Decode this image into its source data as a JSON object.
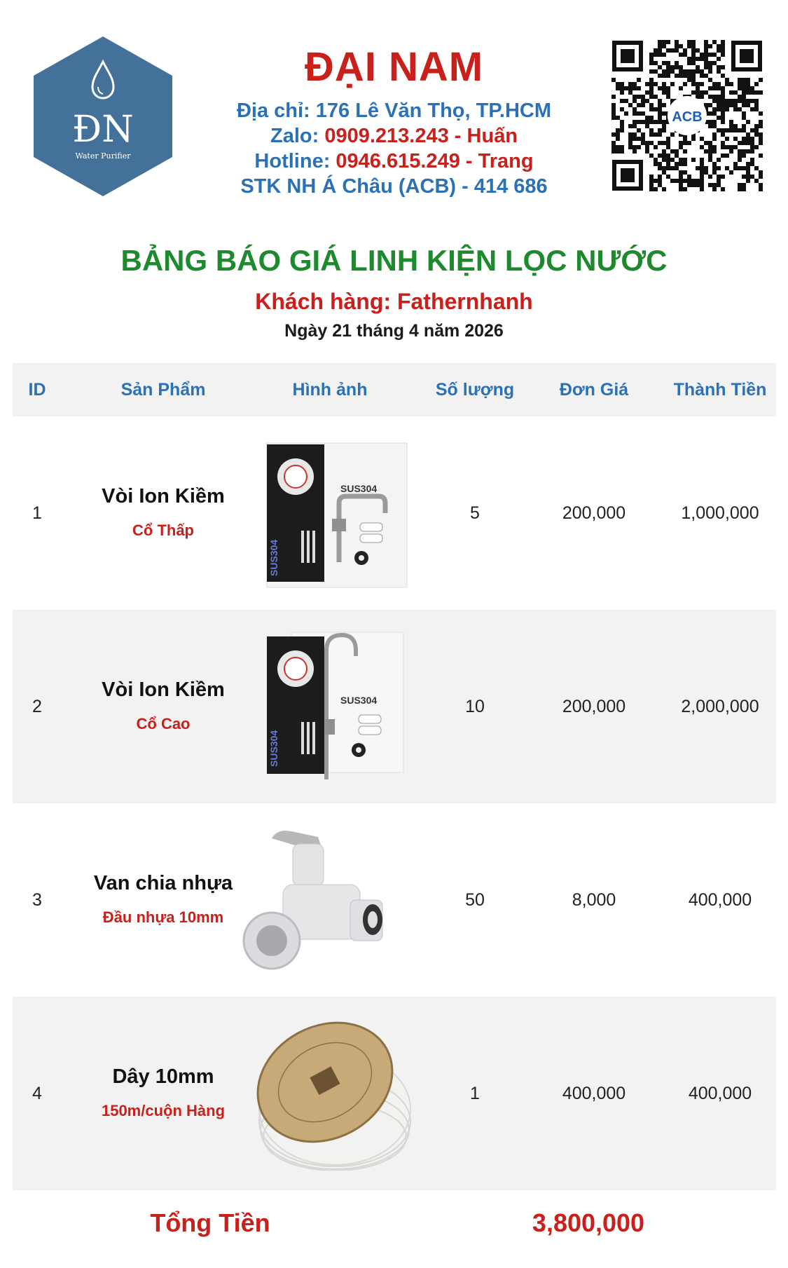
{
  "header": {
    "logo": {
      "monogram": "ĐN",
      "tagline": "Water Purifier"
    },
    "company_name": "ĐẠI NAM",
    "address_label": "Địa chỉ: ",
    "address_value": "176 Lê Văn Thọ, TP.HCM",
    "zalo_label": "Zalo: ",
    "zalo_value": "0909.213.243 - Huấn",
    "hotline_label": "Hotline: ",
    "hotline_value": "0946.615.249 - Trang",
    "bank_text": "STK NH Á Châu (ACB) - 414 686",
    "qr_badge": "ACB"
  },
  "document": {
    "title": "BẢNG BÁO GIÁ LINH KIỆN LỌC NƯỚC",
    "customer": "Khách hàng: Fathernhanh",
    "date": "Ngày 21 tháng 4 năm 2026"
  },
  "table": {
    "columns": [
      "ID",
      "Sản Phẩm",
      "Hình ảnh",
      "Số lượng",
      "Đơn Giá",
      "Thành Tiền"
    ],
    "rows": [
      {
        "id": "1",
        "name": "Vòi Ion Kiềm",
        "sub": "Cổ Thấp",
        "image": "sus304-faucet-low-neck-icon",
        "qty": "5",
        "price": "200,000",
        "total": "1,000,000"
      },
      {
        "id": "2",
        "name": "Vòi Ion Kiềm",
        "sub": "Cổ Cao",
        "image": "sus304-faucet-high-neck-icon",
        "qty": "10",
        "price": "200,000",
        "total": "2,000,000"
      },
      {
        "id": "3",
        "name": "Van chia nhựa",
        "sub": "Đầu nhựa 10mm",
        "image": "plastic-valve-icon",
        "qty": "50",
        "price": "8,000",
        "total": "400,000"
      },
      {
        "id": "4",
        "name": "Dây 10mm",
        "sub": "150m/cuộn Hàng",
        "image": "hose-coil-icon",
        "qty": "1",
        "price": "400,000",
        "total": "400,000"
      }
    ]
  },
  "summary": {
    "label": "Tổng Tiền",
    "value": "3,800,000"
  },
  "colors": {
    "red": "#c9201b",
    "blue": "#2a72b5",
    "green": "#1e8a2e",
    "row_shade": "#f2f2f2"
  }
}
